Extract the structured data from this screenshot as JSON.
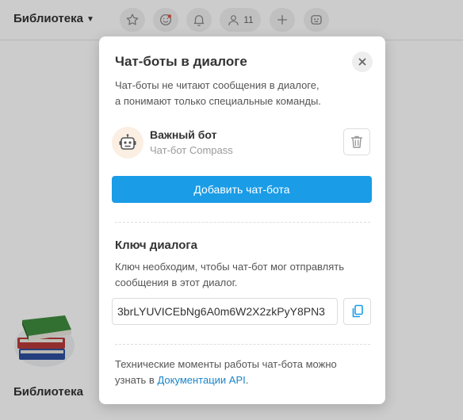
{
  "header": {
    "title": "Библиотека",
    "members_count": "11"
  },
  "background": {
    "chat_name": "Библиотека"
  },
  "modal": {
    "title": "Чат-боты в диалоге",
    "intro_line1": "Чат-боты не читают сообщения в диалоге,",
    "intro_line2": "а понимают только специальные команды.",
    "bot": {
      "name": "Важный бот",
      "subtitle": "Чат-бот Compass"
    },
    "add_button_label": "Добавить чат-бота",
    "key_section": {
      "title": "Ключ диалога",
      "desc_line1": "Ключ необходим, чтобы чат-бот мог отправлять",
      "desc_line2": "сообщения в этот диалог.",
      "key_value": "3brLYUVICEbNg6A0m6W2X2zkPyY8PN3"
    },
    "footer": {
      "line1": "Технические моменты работы чат-бота можно",
      "prefix": "узнать в ",
      "link": "Документации API",
      "suffix": "."
    }
  },
  "colors": {
    "accent": "#1a9ce6",
    "link": "#1a85c9"
  },
  "icons": [
    "chevron-down-icon",
    "star-icon",
    "smile-icon",
    "bell-icon",
    "user-icon",
    "plus-icon",
    "bot-icon",
    "close-icon",
    "trash-icon",
    "copy-icon"
  ]
}
